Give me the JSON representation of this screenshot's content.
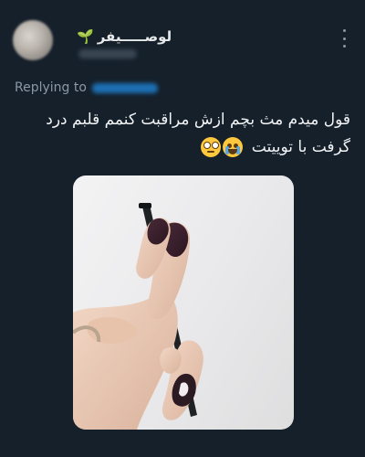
{
  "tweet": {
    "author": {
      "display_name": "لوصـــــیفر",
      "name_emoji": "🌱"
    },
    "reply": {
      "prefix": "Replying to"
    },
    "text": "قول میدم مث بچم ازش مراقبت کنمم قلبم درد گرفت با توییتت",
    "emojis": [
      "loudly-crying-face",
      "face-with-rolling-eyes"
    ],
    "image": {
      "subject": "hand-holding-stylus-pen"
    }
  },
  "colors": {
    "background": "#15202b",
    "text": "#e7e9ea",
    "secondary": "#8b98a5",
    "link": "#1d9bf0"
  }
}
